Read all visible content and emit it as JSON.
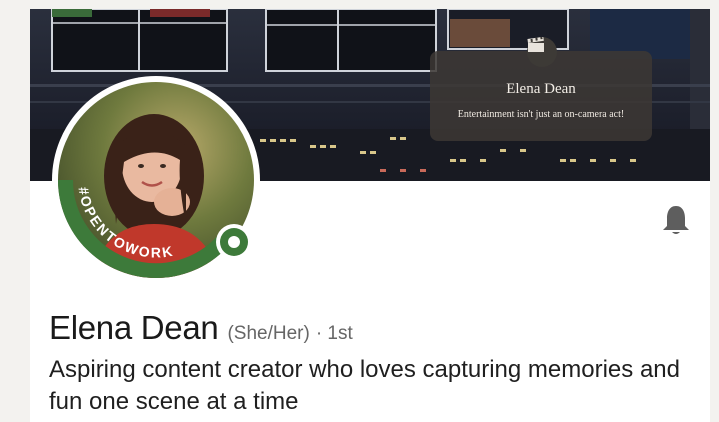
{
  "banner": {
    "overlay_name": "Elena Dean",
    "overlay_tagline": "Entertainment isn't just an on-camera act!",
    "icon": "clapperboard-icon"
  },
  "profile": {
    "badge_text": "#OPENTOWORK",
    "badge_color": "#3d7a3a",
    "name": "Elena Dean",
    "pronouns": "(She/Her)",
    "connection_degree": "· 1st",
    "headline": "Aspiring content creator who loves capturing memories and fun one scene at a time"
  },
  "actions": {
    "notify_icon": "bell-icon"
  },
  "colors": {
    "page_background": "#f3f2ef",
    "card_background": "#ffffff",
    "text_primary": "#1a1a1a",
    "text_secondary": "#666666",
    "open_to_work_green": "#3d7a3a"
  }
}
